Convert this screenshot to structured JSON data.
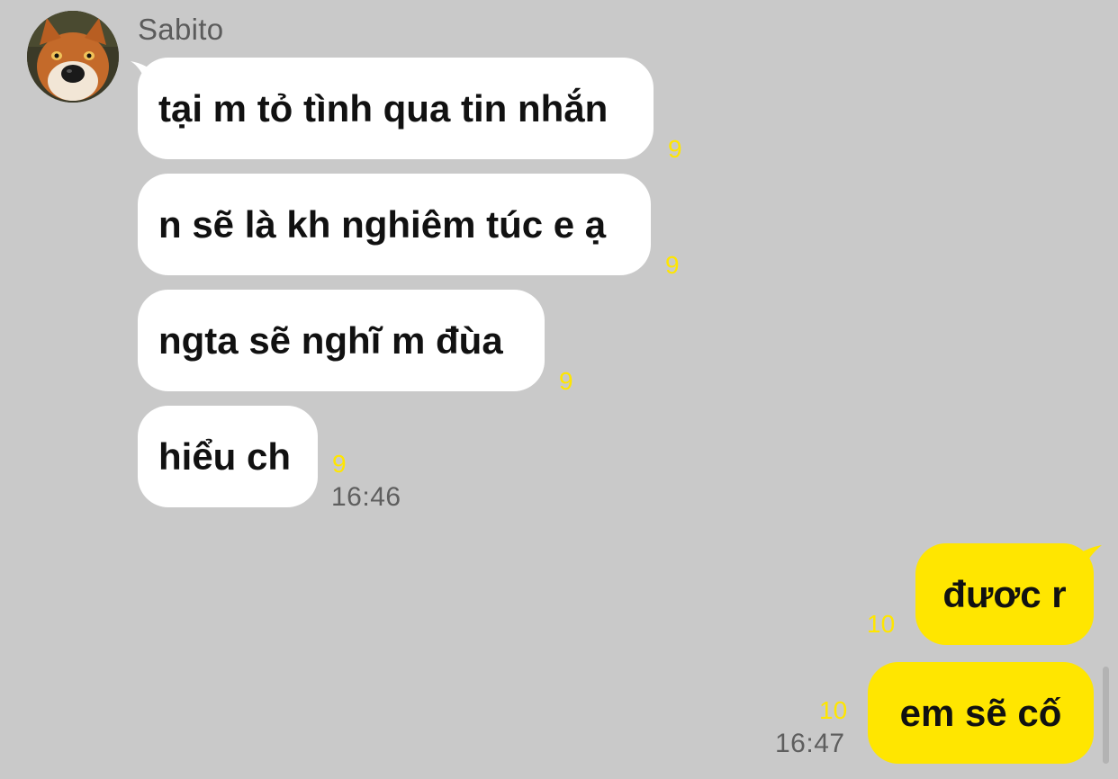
{
  "conversation": {
    "sender": "Sabito",
    "incoming": [
      {
        "text": "tại m tỏ tình qua tin nhắn",
        "unread": "9"
      },
      {
        "text": "n sẽ là kh nghiêm túc e ạ",
        "unread": "9"
      },
      {
        "text": "ngta sẽ nghĩ m đùa",
        "unread": "9"
      },
      {
        "text": "hiểu ch",
        "unread": "9"
      }
    ],
    "incoming_time": "16:46",
    "outgoing": [
      {
        "text": "đươc r",
        "unread": "10"
      },
      {
        "text": "em sẽ cố",
        "unread": "10"
      }
    ],
    "outgoing_time": "16:47"
  },
  "colors": {
    "background": "#c9c9c9",
    "incoming_bubble": "#ffffff",
    "outgoing_bubble": "#ffe600",
    "unread_count": "#ffe600",
    "timestamp": "#5e5e5e"
  },
  "icons": {
    "avatar": "fox-avatar"
  }
}
